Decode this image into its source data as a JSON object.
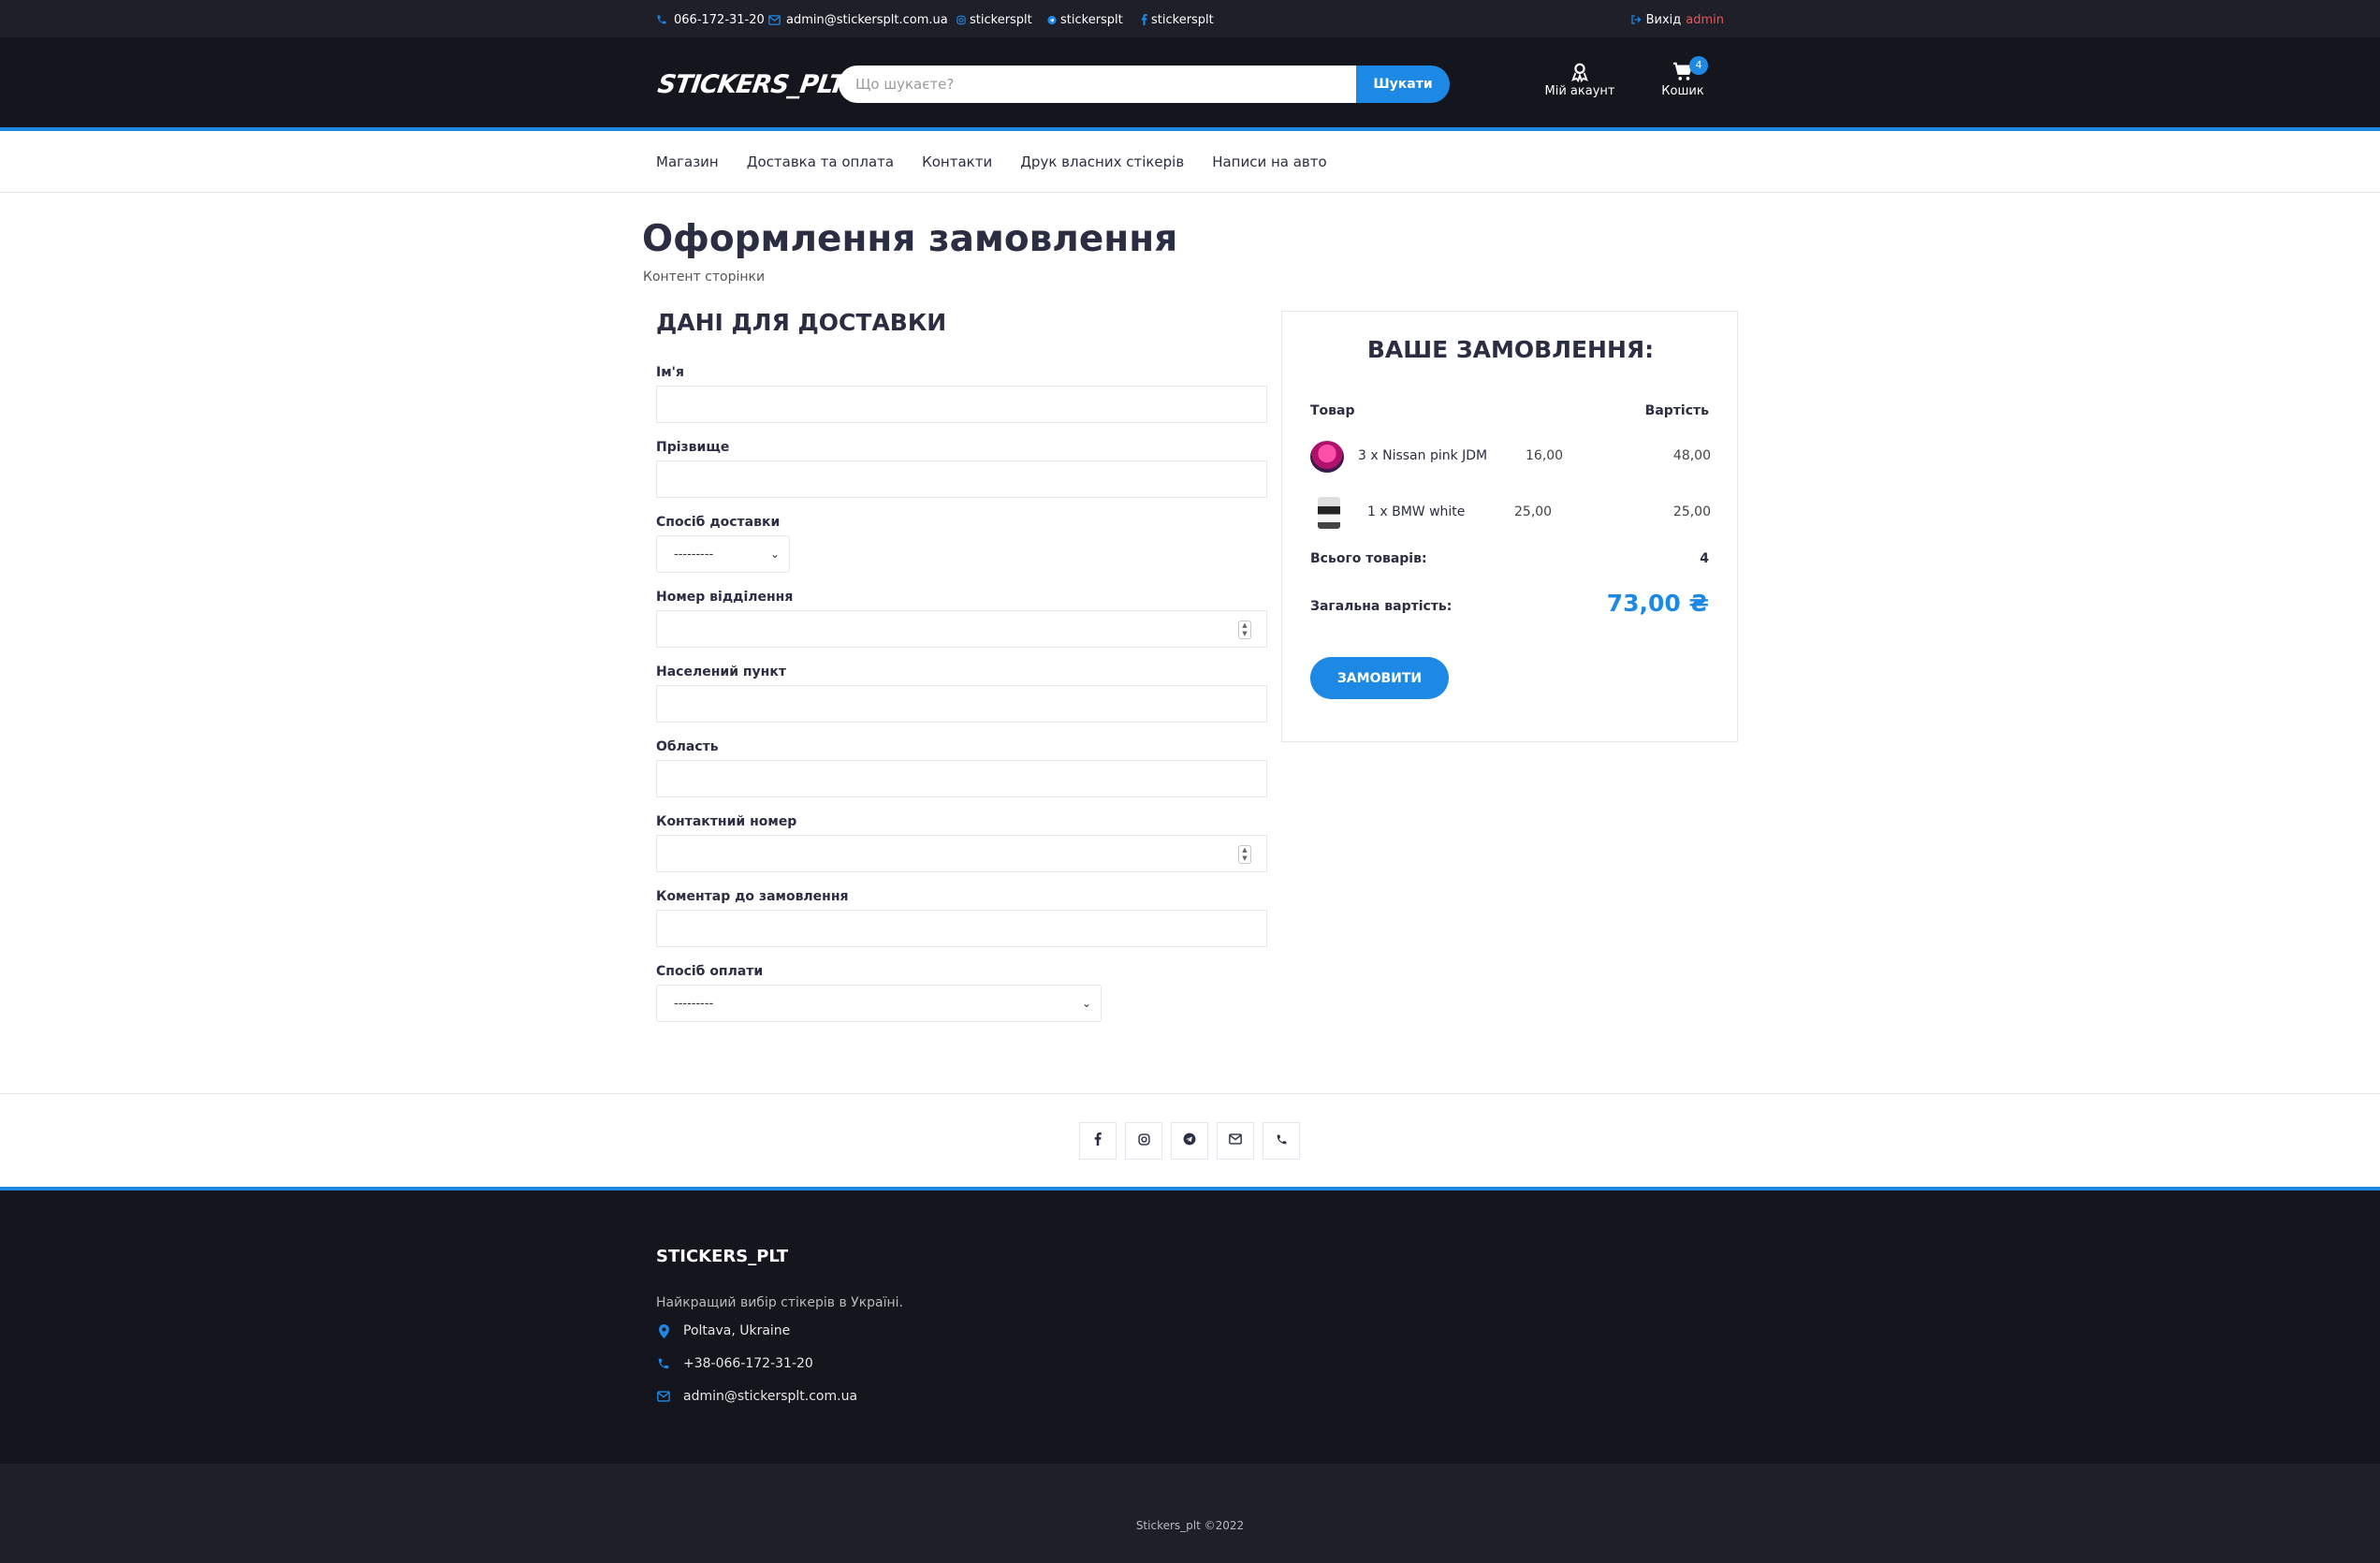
{
  "topbar": {
    "phone": "066-172-31-20",
    "email": "admin@stickersplt.com.ua",
    "instagram": "stickersplt",
    "telegram": "stickersplt",
    "facebook": "stickersplt",
    "logout_label": "Вихід",
    "user": "admin"
  },
  "header": {
    "logo": "STICKERS_PLT",
    "search_placeholder": "Що шукаєте?",
    "search_button": "Шукати",
    "account_label": "Мій акаунт",
    "cart_label": "Кошик",
    "cart_count": "4"
  },
  "nav": {
    "items": [
      "Магазин",
      "Доставка та оплата",
      "Контакти",
      "Друк власних стікерів",
      "Написи на авто"
    ]
  },
  "page": {
    "title": "Оформлення замовлення",
    "subtitle": "Контент сторінки"
  },
  "form": {
    "title": "ДАНІ ДЛЯ ДОСТАВКИ",
    "first_name_label": "Ім'я",
    "last_name_label": "Прізвище",
    "delivery_method_label": "Спосіб доставки",
    "delivery_method_value": "---------",
    "branch_label": "Номер відділення",
    "city_label": "Населений пункт",
    "region_label": "Область",
    "phone_label": "Контактний номер",
    "comment_label": "Коментар до замовлення",
    "payment_label": "Спосіб оплати",
    "payment_value": "---------"
  },
  "order": {
    "title": "ВАШЕ ЗАМОВЛЕННЯ:",
    "col_product": "Товар",
    "col_cost": "Вартість",
    "items": [
      {
        "name": "3 x Nissan pink JDM",
        "price": "16,00",
        "total": "48,00"
      },
      {
        "name": "1 x BMW white",
        "price": "25,00",
        "total": "25,00"
      }
    ],
    "count_label": "Всього товарів:",
    "count_value": "4",
    "total_label": "Загальна вартість:",
    "total_value": "73,00 ₴",
    "submit_label": "ЗАМОВИТИ"
  },
  "footer": {
    "title": "STICKERS_PLT",
    "description": "Найкращий вибір стікерів в Україні.",
    "location": "Poltava, Ukraine",
    "phone": "+38-066-172-31-20",
    "email": "admin@stickersplt.com.ua",
    "copyright": "Stickers_plt ©2022"
  },
  "colors": {
    "accent": "#1e88e5",
    "header_bg": "#15161d",
    "topbar_bg": "#1e1f29",
    "logo_dot": "#e50914",
    "admin_name": "#ee5454"
  }
}
